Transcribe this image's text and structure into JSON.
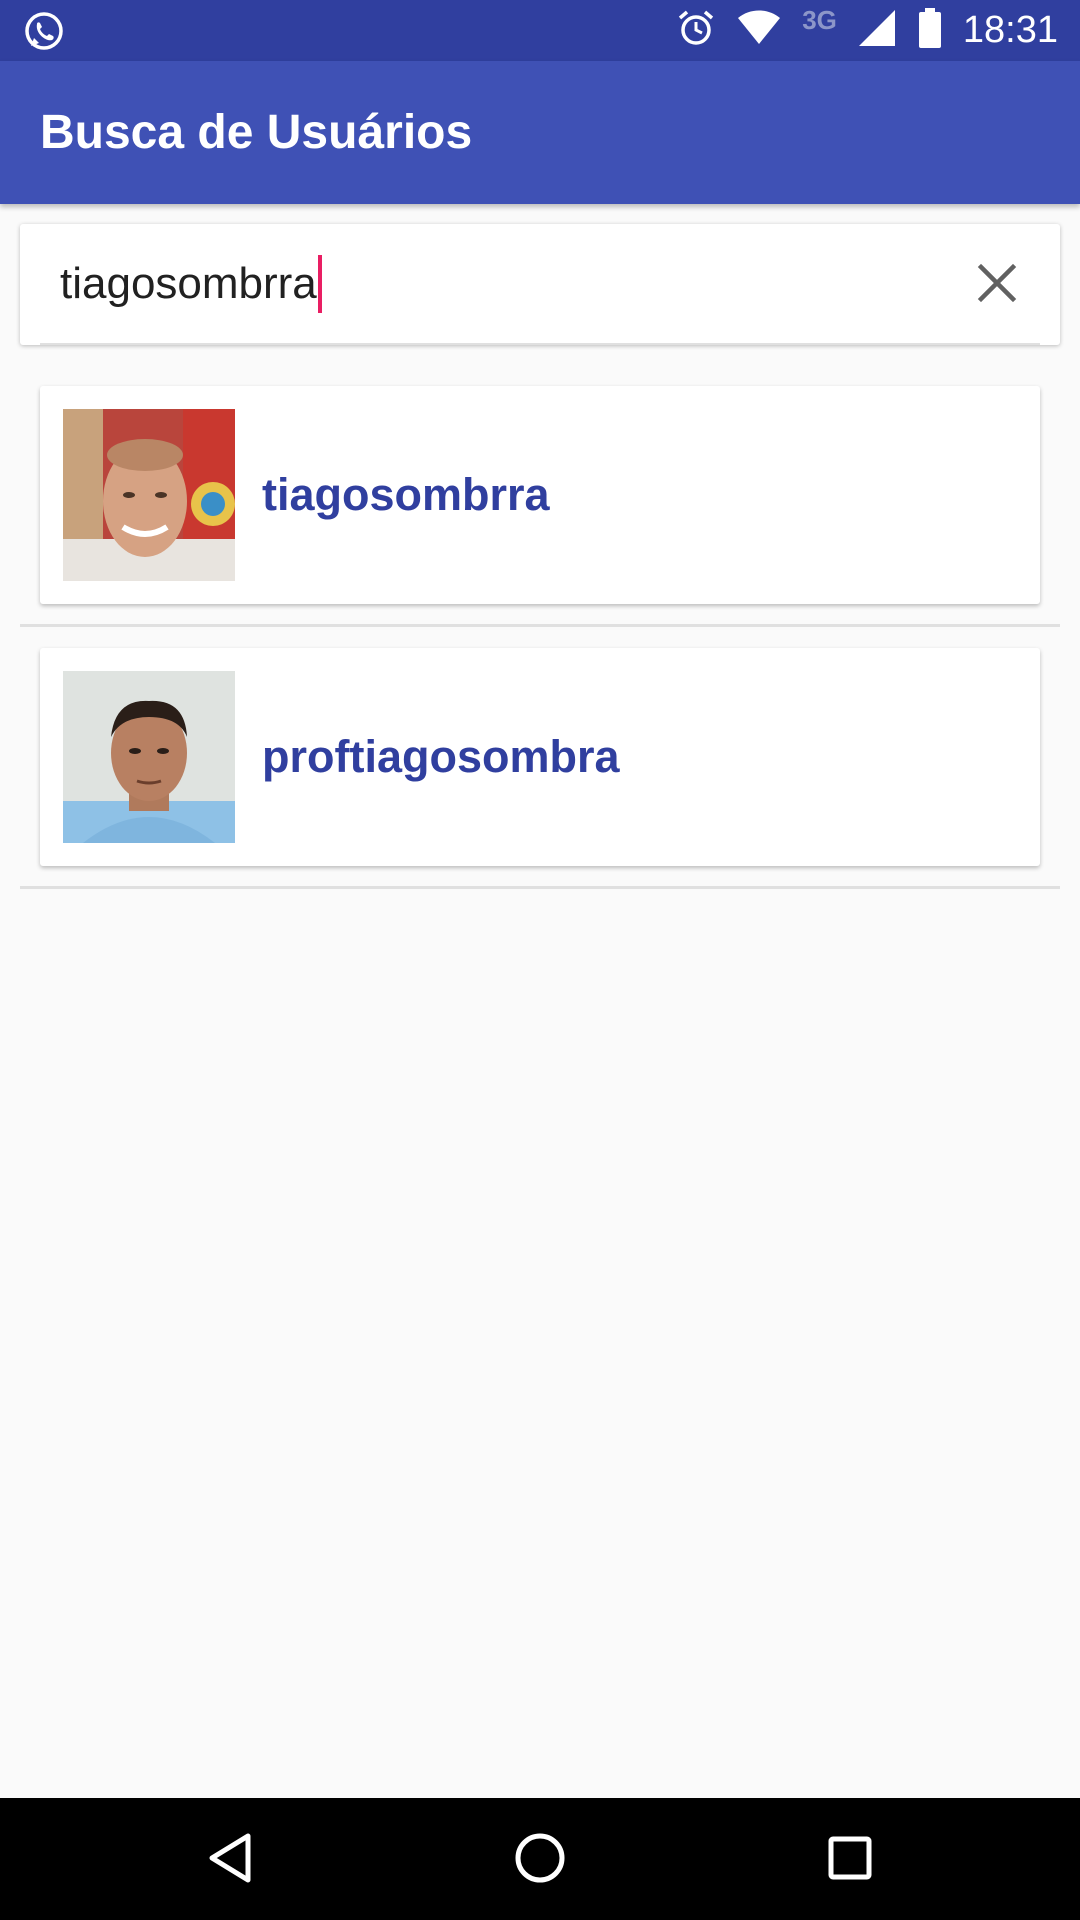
{
  "status_bar": {
    "notification_icon": "whatsapp-icon",
    "alarm_icon": "alarm-icon",
    "wifi_icon": "wifi-icon",
    "network_type": "3G",
    "signal_icon": "signal-icon",
    "battery_icon": "battery-icon",
    "time": "18:31"
  },
  "app_bar": {
    "title": "Busca de Usuários"
  },
  "search": {
    "value": "tiagosombrra",
    "clear_icon": "close-icon"
  },
  "results": [
    {
      "username": "tiagosombrra"
    },
    {
      "username": "proftiagosombra"
    }
  ],
  "nav_bar": {
    "back_icon": "back-triangle-icon",
    "home_icon": "home-circle-icon",
    "recents_icon": "recents-square-icon"
  },
  "colors": {
    "status_bar": "#303f9f",
    "app_bar": "#3f51b5",
    "username": "#303f9f",
    "caret": "#e91e63"
  }
}
